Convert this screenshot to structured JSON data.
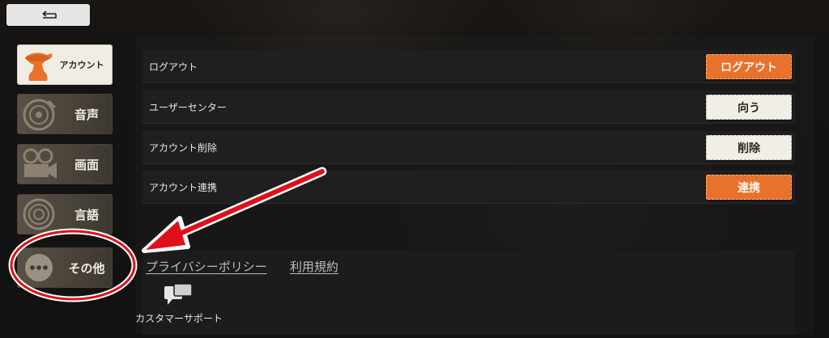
{
  "tabs": [
    {
      "label": "アカウント",
      "active": true
    },
    {
      "label": "音声",
      "active": false
    },
    {
      "label": "画面",
      "active": false
    },
    {
      "label": "言語",
      "active": false
    },
    {
      "label": "その他",
      "active": false
    }
  ],
  "rows": [
    {
      "label": "ログアウト",
      "button": "ログアウト",
      "style": "orange"
    },
    {
      "label": "ユーザーセンター",
      "button": "向う",
      "style": "light"
    },
    {
      "label": "アカウント削除",
      "button": "削除",
      "style": "light"
    },
    {
      "label": "アカウント連携",
      "button": "連携",
      "style": "orange"
    }
  ],
  "links": {
    "privacy": "プライバシーポリシー",
    "terms": "利用規約"
  },
  "support": {
    "label": "カスタマーサポート"
  },
  "colors": {
    "accent": "#e8722b",
    "annotation": "#e0101a"
  }
}
